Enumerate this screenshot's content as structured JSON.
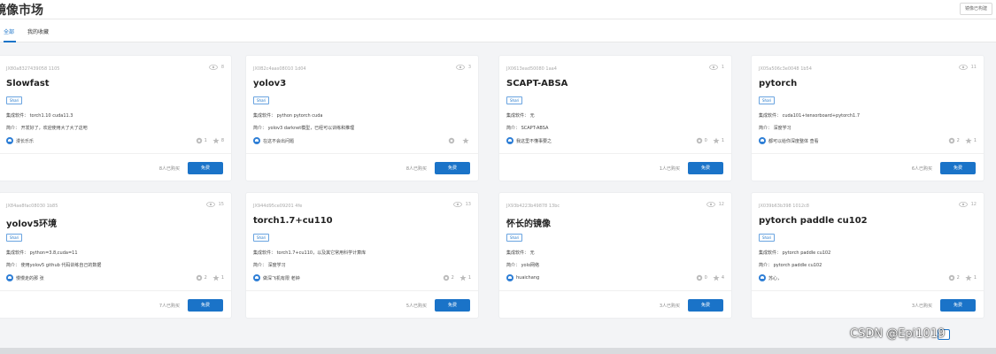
{
  "header": {
    "title": "镜像市场",
    "action_label": "镜像已构建"
  },
  "tabs": [
    {
      "label": "全部",
      "active": true
    },
    {
      "label": "我的收藏",
      "active": false
    }
  ],
  "cards": [
    {
      "id": "JX80a8327439058 1105",
      "views": "8",
      "name": "Slowfast",
      "tag": "Shari",
      "software": "集成软件： torch1.10 cuda11.3",
      "intro": "简介：   开发好了，欢迎使用大了大了这吧",
      "author": "漫长乐乐",
      "forks": "1",
      "stars": "8",
      "buyers": "8人已购买",
      "button": "免费"
    },
    {
      "id": "JX0B2c4aas08010 1d04",
      "views": "3",
      "name": "yolov3",
      "tag": "Shari",
      "software": "集成软件： python pytorch cuda",
      "intro": "简介：  yolov3 darknet模型，已经可以训练和推理",
      "author": "在这不会出问题",
      "forks": "",
      "stars": "",
      "buyers": "8人已购买",
      "button": "免费"
    },
    {
      "id": "JX0613ead50080 1aa4",
      "views": "1",
      "name": "SCAPT-ABSA",
      "tag": "Shari",
      "software": "集成软件：  无",
      "intro": "简介：  SCAPT-ABSA",
      "author": "我这里不懂事要之",
      "forks": "0",
      "stars": "1",
      "buyers": "1人已购买",
      "button": "免费"
    },
    {
      "id": "JX05a506c3e0048 1b54",
      "views": "11",
      "name": "pytorch",
      "tag": "Shari",
      "software": "集成软件：  cuda101+tensorboard+pytorch1.7",
      "intro": "简介：  深度学习",
      "author": "都可以给你深度整体 查看",
      "forks": "2",
      "stars": "1",
      "buyers": "6人已购买",
      "button": "免费"
    },
    {
      "id": "JX84ae8fac08030 1b85",
      "views": "15",
      "name": "yolov5环境",
      "tag": "Shari",
      "software": "集成软件：  python=3.8,cuda=11",
      "intro": "简介：  使用yolov5 github 代码训练自己的数据",
      "author": "慢慢走的那 张",
      "forks": "2",
      "stars": "1",
      "buyers": "7人已购买",
      "button": "免费"
    },
    {
      "id": "JX944d95ce09201 4fe",
      "views": "13",
      "name": "torch1.7+cu110",
      "tag": "Shari",
      "software": "集成软件：  torch1.7+cu110，以及其它常用科学计算库",
      "intro": "简介：  深度学习",
      "author": "做深飞机有限 老钟",
      "forks": "2",
      "stars": "1",
      "buyers": "5人已购买",
      "button": "免费"
    },
    {
      "id": "JX93b4223b49878 13bc",
      "views": "12",
      "name": "怀长的镜像",
      "tag": "Shari",
      "software": "集成软件：  无",
      "intro": "简介：  yolo网络",
      "author": "huaichang",
      "forks": "0",
      "stars": "4",
      "buyers": "3人已购买",
      "button": "免费"
    },
    {
      "id": "JX039b63b398 1012c8",
      "views": "12",
      "name": "pytorch paddle cu102",
      "tag": "Shari",
      "software": "集成软件：  pytorch paddle cu102",
      "intro": "简介：  pytorch paddle cu102",
      "author": "苏心，",
      "forks": "2",
      "stars": "1",
      "buyers": "3人已购买",
      "button": "免费"
    }
  ],
  "watermark": "CSDN @Epi1019"
}
